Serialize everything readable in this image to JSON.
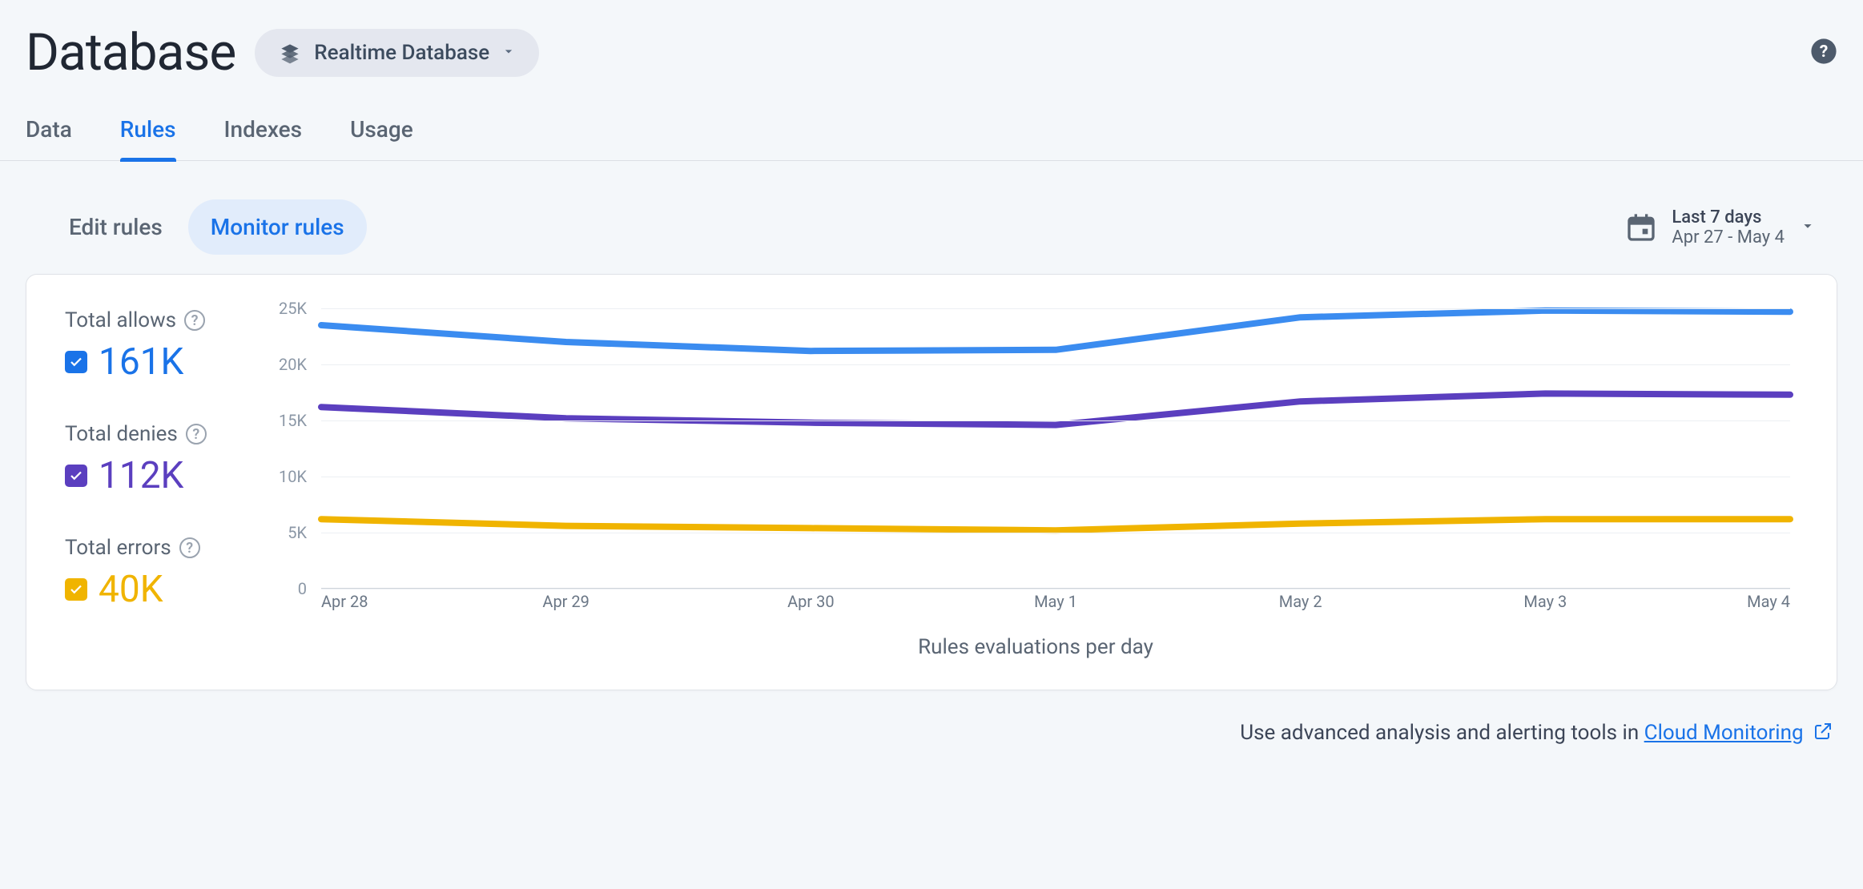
{
  "header": {
    "title": "Database",
    "selector_label": "Realtime Database"
  },
  "tabs": [
    {
      "id": "data",
      "label": "Data",
      "active": false
    },
    {
      "id": "rules",
      "label": "Rules",
      "active": true
    },
    {
      "id": "indexes",
      "label": "Indexes",
      "active": false
    },
    {
      "id": "usage",
      "label": "Usage",
      "active": false
    }
  ],
  "subtabs": [
    {
      "id": "edit",
      "label": "Edit rules",
      "active": false
    },
    {
      "id": "monitor",
      "label": "Monitor rules",
      "active": true
    }
  ],
  "date_range": {
    "label": "Last 7 days",
    "range": "Apr 27 - May 4"
  },
  "legend": {
    "allows": {
      "label": "Total allows",
      "value": "161K",
      "color": "#1a73e8"
    },
    "denies": {
      "label": "Total denies",
      "value": "112K",
      "color": "#5b3fbf"
    },
    "errors": {
      "label": "Total errors",
      "value": "40K",
      "color": "#f0b400"
    }
  },
  "chart_data": {
    "type": "line",
    "title": "Rules evaluations per day",
    "ylabel": "",
    "xlabel": "",
    "ylim": [
      0,
      25000
    ],
    "y_ticks": [
      0,
      5000,
      10000,
      15000,
      20000,
      25000
    ],
    "y_tick_labels": [
      "0",
      "5K",
      "10K",
      "15K",
      "20K",
      "25K"
    ],
    "categories": [
      "Apr 28",
      "Apr 29",
      "Apr 30",
      "May 1",
      "May 2",
      "May 3",
      "May 4"
    ],
    "series": [
      {
        "name": "allows",
        "color": "#3b8cf0",
        "values": [
          23500,
          22000,
          21200,
          21300,
          24200,
          24800,
          24700
        ]
      },
      {
        "name": "denies",
        "color": "#5b3fbf",
        "values": [
          16200,
          15200,
          14800,
          14600,
          16700,
          17400,
          17300
        ]
      },
      {
        "name": "errors",
        "color": "#f0b400",
        "values": [
          6200,
          5600,
          5400,
          5200,
          5800,
          6200,
          6200
        ]
      }
    ]
  },
  "footer": {
    "text": "Use advanced analysis and alerting tools in ",
    "link": "Cloud Monitoring"
  }
}
